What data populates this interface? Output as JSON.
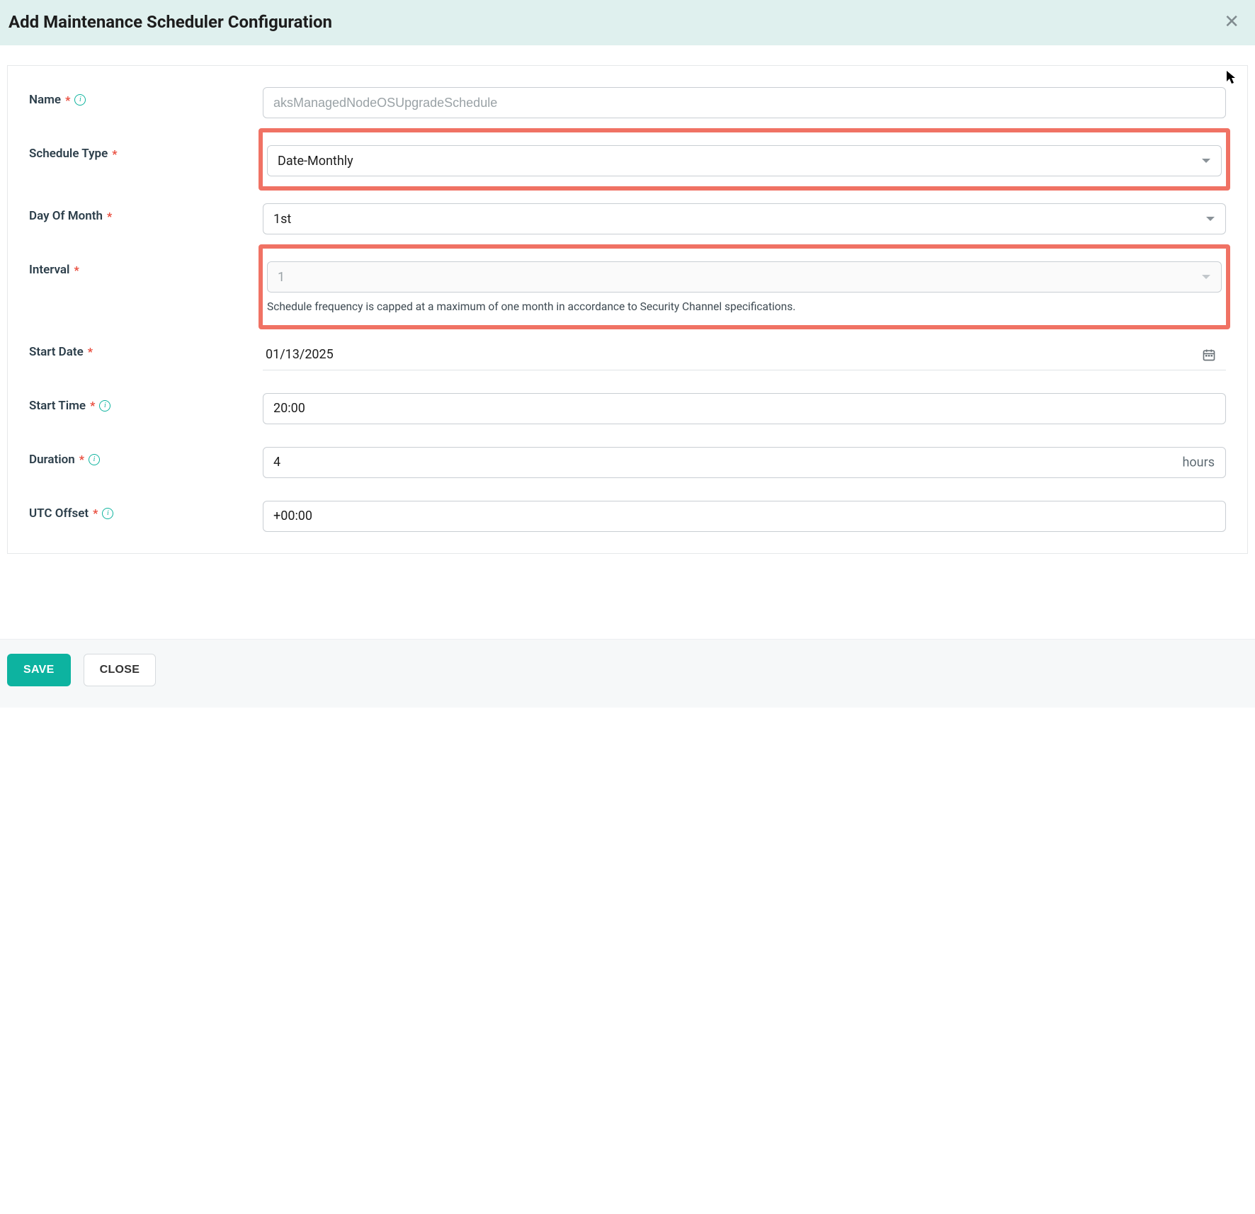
{
  "header": {
    "title": "Add Maintenance Scheduler Configuration"
  },
  "fields": {
    "name": {
      "label": "Name",
      "placeholder": "aksManagedNodeOSUpgradeSchedule",
      "value": ""
    },
    "scheduleType": {
      "label": "Schedule Type",
      "value": "Date-Monthly"
    },
    "dayOfMonth": {
      "label": "Day Of Month",
      "value": "1st"
    },
    "interval": {
      "label": "Interval",
      "value": "1",
      "helper": "Schedule frequency is capped at a maximum of one month in accordance to Security Channel specifications."
    },
    "startDate": {
      "label": "Start Date",
      "value": "01/13/2025"
    },
    "startTime": {
      "label": "Start Time",
      "value": "20:00"
    },
    "duration": {
      "label": "Duration",
      "value": "4",
      "suffix": "hours"
    },
    "utcOffset": {
      "label": "UTC Offset",
      "value": "+00:00"
    }
  },
  "footer": {
    "save": "SAVE",
    "close": "CLOSE"
  }
}
